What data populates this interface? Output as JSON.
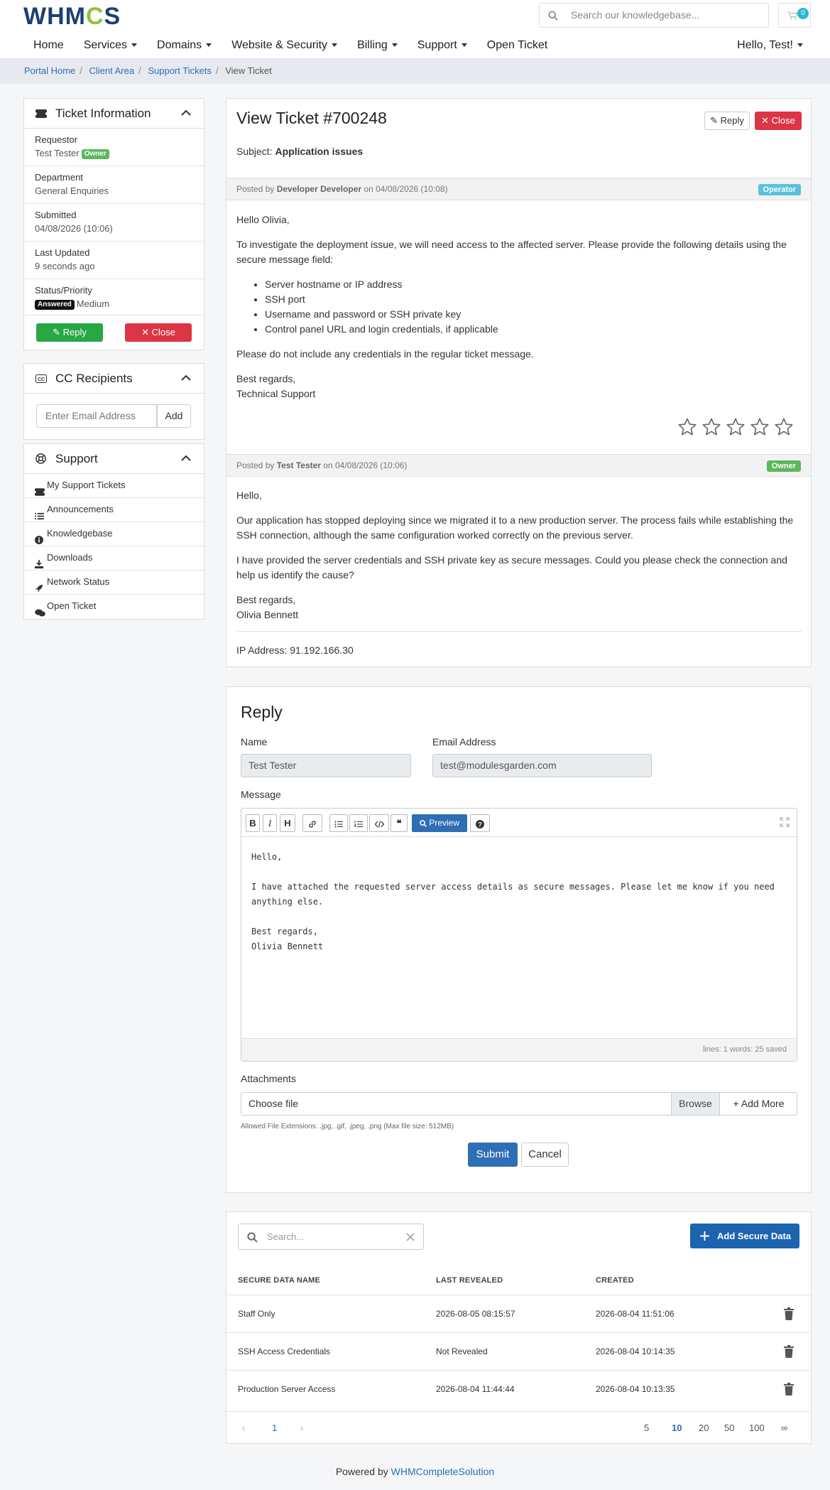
{
  "header": {
    "logo": "WHMCS",
    "search_placeholder": "Search our knowledgebase...",
    "cart_count": "0",
    "nav": [
      {
        "label": "Home",
        "dropdown": false
      },
      {
        "label": "Services",
        "dropdown": true
      },
      {
        "label": "Domains",
        "dropdown": true
      },
      {
        "label": "Website & Security",
        "dropdown": true
      },
      {
        "label": "Billing",
        "dropdown": true
      },
      {
        "label": "Support",
        "dropdown": true
      },
      {
        "label": "Open Ticket",
        "dropdown": false
      }
    ],
    "hello": "Hello, Test!"
  },
  "breadcrumb": [
    "Portal Home",
    "Client Area",
    "Support Tickets",
    "View Ticket"
  ],
  "sidebar": {
    "ticket_info": {
      "title": "Ticket Information",
      "rows": [
        {
          "label": "Requestor",
          "value": "Test Tester",
          "tag": "Owner"
        },
        {
          "label": "Department",
          "value": "General Enquiries"
        },
        {
          "label": "Submitted",
          "value": "04/08/2026 (10:06)"
        },
        {
          "label": "Last Updated",
          "value": "9 seconds ago"
        },
        {
          "label": "Status/Priority",
          "value": "Medium",
          "status": "Answered"
        }
      ],
      "reply_label": "Reply",
      "close_label": "Close"
    },
    "cc": {
      "title": "CC Recipients",
      "placeholder": "Enter Email Address",
      "add_label": "Add"
    },
    "support": {
      "title": "Support",
      "items": [
        {
          "label": "My Support Tickets",
          "icon": "ticket-icon"
        },
        {
          "label": "Announcements",
          "icon": "list-icon"
        },
        {
          "label": "Knowledgebase",
          "icon": "info-icon"
        },
        {
          "label": "Downloads",
          "icon": "download-icon"
        },
        {
          "label": "Network Status",
          "icon": "rocket-icon"
        },
        {
          "label": "Open Ticket",
          "icon": "comments-icon"
        }
      ]
    }
  },
  "ticket": {
    "title": "View Ticket #700248",
    "subject_label": "Subject:",
    "subject": "Application issues",
    "reply_label": "Reply",
    "close_label": "Close",
    "messages": [
      {
        "posted_by_prefix": "Posted by",
        "author": "Developer Developer",
        "on": "on 04/08/2026 (10:08)",
        "role": "Operator",
        "greeting": "Hello Olivia,",
        "p1": "To investigate the deployment issue, we will need access to the affected server. Please provide the following details using the secure message field:",
        "list": [
          "Server hostname or IP address",
          "SSH port",
          "Username and password or SSH private key",
          "Control panel URL and login credentials, if applicable"
        ],
        "p2": "Please do not include any credentials in the regular ticket message.",
        "sign1": "Best regards,",
        "sign2": "Technical Support"
      },
      {
        "posted_by_prefix": "Posted by",
        "author": "Test Tester",
        "on": "on 04/08/2026 (10:06)",
        "role": "Owner",
        "greeting": "Hello,",
        "p1": "Our application has stopped deploying since we migrated it to a new production server. The process fails while establishing the SSH connection, although the same configuration worked correctly on the previous server.",
        "p2": "I have provided the server credentials and SSH private key as secure messages. Could you please check the connection and help us identify the cause?",
        "sign1": "Best regards,",
        "sign2": "Olivia Bennett",
        "ip": "IP Address: 91.192.166.30"
      }
    ]
  },
  "reply": {
    "title": "Reply",
    "name_label": "Name",
    "name_value": "Test Tester",
    "email_label": "Email Address",
    "email_value": "test@modulesgarden.com",
    "message_label": "Message",
    "preview_label": "Preview",
    "message_text": "Hello,\n\nI have attached the requested server access details as secure messages. Please let me know if you need anything else.\n\nBest regards,\nOlivia Bennett",
    "status": "lines: 1   words: 25   saved",
    "attachments_label": "Attachments",
    "choose_file": "Choose file",
    "browse": "Browse",
    "add_more": "Add More",
    "allowed": "Allowed File Extensions: .jpg, .gif, .jpeg, .png (Max file size: 512MB)",
    "submit": "Submit",
    "cancel": "Cancel"
  },
  "secure": {
    "search_placeholder": "Search...",
    "add_label": "Add Secure Data",
    "columns": [
      "SECURE DATA NAME",
      "LAST REVEALED",
      "CREATED"
    ],
    "rows": [
      {
        "name": "Staff Only",
        "revealed": "2026-08-05 08:15:57",
        "created": "2026-08-04 11:51:06"
      },
      {
        "name": "SSH Access Credentials",
        "revealed": "Not Revealed",
        "created": "2026-08-04 10:14:35"
      },
      {
        "name": "Production Server Access",
        "revealed": "2026-08-04 11:44:44",
        "created": "2026-08-04 10:13:35"
      }
    ],
    "page": "1",
    "page_sizes": [
      "5",
      "10",
      "20",
      "50",
      "100",
      "∞"
    ],
    "active_size": "10"
  },
  "footer": {
    "prefix": "Powered by",
    "link": "WHMCompleteSolution"
  }
}
